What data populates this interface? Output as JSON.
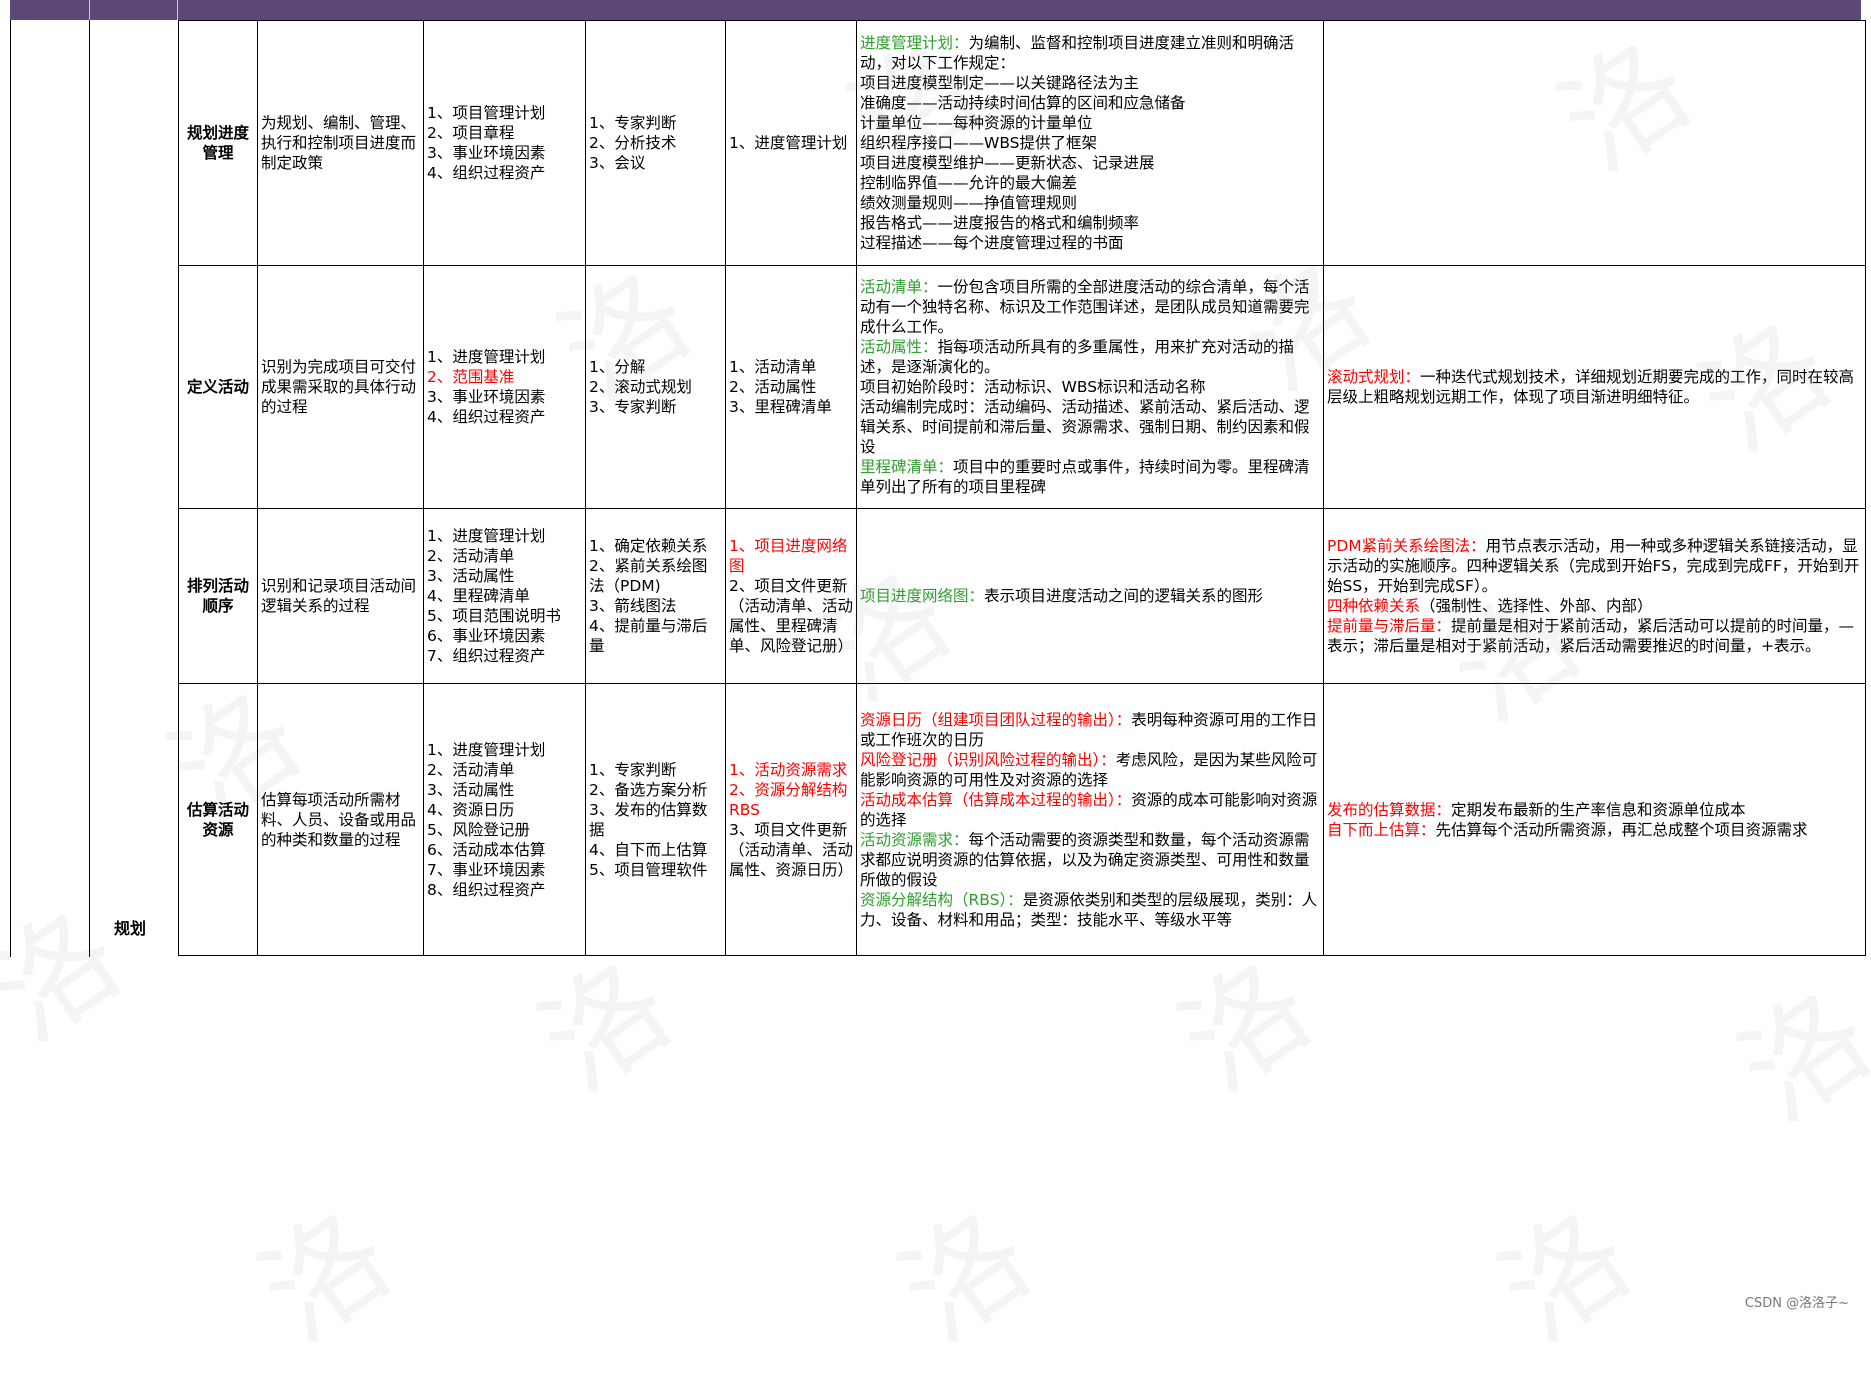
{
  "stage_label": "规划",
  "rows": [
    {
      "process": "规划进度管理",
      "purpose": "为规划、编制、管理、执行和控制项目进度而制定政策",
      "inputs": [
        {
          "text": "1、项目管理计划"
        },
        {
          "text": "2、项目章程"
        },
        {
          "text": "3、事业环境因素"
        },
        {
          "text": "4、组织过程资产"
        }
      ],
      "tools": [
        {
          "text": "1、专家判断"
        },
        {
          "text": "2、分析技术"
        },
        {
          "text": "3、会议"
        }
      ],
      "outputs": [
        {
          "text": "1、进度管理计划"
        }
      ],
      "notes": [
        {
          "head": "进度管理计划：",
          "head_color": "green",
          "body": "为编制、监督和控制项目进度建立准则和明确活动，对以下工作规定："
        },
        {
          "head": "",
          "head_color": "",
          "body": "项目进度模型制定——以关键路径法为主"
        },
        {
          "head": "",
          "head_color": "",
          "body": "准确度——活动持续时间估算的区间和应急储备"
        },
        {
          "head": "",
          "head_color": "",
          "body": "计量单位——每种资源的计量单位"
        },
        {
          "head": "",
          "head_color": "",
          "body": "组织程序接口——WBS提供了框架"
        },
        {
          "head": "",
          "head_color": "",
          "body": "项目进度模型维护——更新状态、记录进展"
        },
        {
          "head": "",
          "head_color": "",
          "body": "控制临界值——允许的最大偏差"
        },
        {
          "head": "",
          "head_color": "",
          "body": "绩效测量规则——挣值管理规则"
        },
        {
          "head": "",
          "head_color": "",
          "body": "报告格式——进度报告的格式和编制频率"
        },
        {
          "head": "",
          "head_color": "",
          "body": "过程描述——每个进度管理过程的书面"
        }
      ],
      "extra": []
    },
    {
      "process": "定义活动",
      "purpose": "识别为完成项目可交付成果需采取的具体行动的过程",
      "inputs": [
        {
          "text": "1、进度管理计划"
        },
        {
          "text": "2、范围基准",
          "color": "red"
        },
        {
          "text": "3、事业环境因素"
        },
        {
          "text": "4、组织过程资产"
        }
      ],
      "tools": [
        {
          "text": "1、分解"
        },
        {
          "text": "2、滚动式规划"
        },
        {
          "text": "3、专家判断"
        }
      ],
      "outputs": [
        {
          "text": "1、活动清单"
        },
        {
          "text": "2、活动属性"
        },
        {
          "text": "3、里程碑清单"
        }
      ],
      "notes": [
        {
          "head": "活动清单：",
          "head_color": "green",
          "body": "一份包含项目所需的全部进度活动的综合清单，每个活动有一个独特名称、标识及工作范围详述，是团队成员知道需要完成什么工作。"
        },
        {
          "head": "活动属性：",
          "head_color": "green",
          "body": "指每项活动所具有的多重属性，用来扩充对活动的描述，是逐渐演化的。"
        },
        {
          "head": "",
          "head_color": "",
          "body": "项目初始阶段时：活动标识、WBS标识和活动名称"
        },
        {
          "head": "",
          "head_color": "",
          "body": "活动编制完成时：活动编码、活动描述、紧前活动、紧后活动、逻辑关系、时间提前和滞后量、资源需求、强制日期、制约因素和假设"
        },
        {
          "head": "里程碑清单：",
          "head_color": "green",
          "body": "项目中的重要时点或事件，持续时间为零。里程碑清单列出了所有的项目里程碑"
        }
      ],
      "extra": [
        {
          "head": "滚动式规划：",
          "head_color": "red",
          "body": "一种迭代式规划技术，详细规划近期要完成的工作，同时在较高层级上粗略规划远期工作，体现了项目渐进明细特征。"
        }
      ]
    },
    {
      "process": "排列活动顺序",
      "purpose": "识别和记录项目活动间逻辑关系的过程",
      "inputs": [
        {
          "text": "1、进度管理计划"
        },
        {
          "text": "2、活动清单"
        },
        {
          "text": "3、活动属性"
        },
        {
          "text": "4、里程碑清单"
        },
        {
          "text": "5、项目范围说明书"
        },
        {
          "text": "6、事业环境因素"
        },
        {
          "text": "7、组织过程资产"
        }
      ],
      "tools": [
        {
          "text": "1、确定依赖关系"
        },
        {
          "text": "2、紧前关系绘图法（PDM)"
        },
        {
          "text": "3、箭线图法"
        },
        {
          "text": "4、提前量与滞后量"
        }
      ],
      "outputs": [
        {
          "text": "1、项目进度网络图",
          "color": "red"
        },
        {
          "text": "2、项目文件更新（活动清单、活动属性、里程碑清单、风险登记册）"
        }
      ],
      "notes": [
        {
          "head": "项目进度网络图：",
          "head_color": "green",
          "body": "表示项目进度活动之间的逻辑关系的图形"
        }
      ],
      "extra": [
        {
          "head": "PDM紧前关系绘图法：",
          "head_color": "red",
          "body": "用节点表示活动，用一种或多种逻辑关系链接活动，显示活动的实施顺序。四种逻辑关系（完成到开始FS，完成到完成FF，开始到开始SS，开始到完成SF）。"
        },
        {
          "head": "四种依赖关系",
          "head_color": "red",
          "body": "（强制性、选择性、外部、内部）"
        },
        {
          "head": "提前量与滞后量：",
          "head_color": "red",
          "body": "提前量是相对于紧前活动，紧后活动可以提前的时间量，—表示；滞后量是相对于紧前活动，紧后活动需要推迟的时间量，+表示。"
        }
      ]
    },
    {
      "process": "估算活动资源",
      "purpose": "估算每项活动所需材料、人员、设备或用品的种类和数量的过程",
      "inputs": [
        {
          "text": "1、进度管理计划"
        },
        {
          "text": "2、活动清单"
        },
        {
          "text": "3、活动属性"
        },
        {
          "text": "4、资源日历"
        },
        {
          "text": "5、风险登记册"
        },
        {
          "text": "6、活动成本估算"
        },
        {
          "text": "7、事业环境因素"
        },
        {
          "text": "8、组织过程资产"
        }
      ],
      "tools": [
        {
          "text": "1、专家判断"
        },
        {
          "text": "2、备选方案分析"
        },
        {
          "text": "3、发布的估算数据"
        },
        {
          "text": "4、自下而上估算"
        },
        {
          "text": "5、项目管理软件"
        }
      ],
      "outputs": [
        {
          "text": "1、活动资源需求",
          "color": "red"
        },
        {
          "text": "2、资源分解结构RBS",
          "color": "red"
        },
        {
          "text": "3、项目文件更新（活动清单、活动属性、资源日历）"
        }
      ],
      "notes": [
        {
          "head": "资源日历（组建项目团队过程的输出）：",
          "head_color": "red",
          "body": "表明每种资源可用的工作日或工作班次的日历"
        },
        {
          "head": "风险登记册（识别风险过程的输出）：",
          "head_color": "red",
          "body": "考虑风险，是因为某些风险可能影响资源的可用性及对资源的选择"
        },
        {
          "head": "活动成本估算（估算成本过程的输出）：",
          "head_color": "red",
          "body": "资源的成本可能影响对资源的选择"
        },
        {
          "head": "活动资源需求：",
          "head_color": "green",
          "body": "每个活动需要的资源类型和数量，每个活动资源需求都应说明资源的估算依据，以及为确定资源类型、可用性和数量所做的假设"
        },
        {
          "head": "资源分解结构（RBS）：",
          "head_color": "green",
          "body": "是资源依类别和类型的层级展现，类别：人力、设备、材料和用品；类型：技能水平、等级水平等"
        }
      ],
      "extra": [
        {
          "head": "发布的估算数据：",
          "head_color": "red",
          "body": "定期发布最新的生产率信息和资源单位成本"
        },
        {
          "head": "自下而上估算：",
          "head_color": "red",
          "body": "先估算每个活动所需资源，再汇总成整个项目资源需求"
        }
      ]
    }
  ],
  "watermark_char": "洛",
  "footer": "CSDN @洛洛子~"
}
